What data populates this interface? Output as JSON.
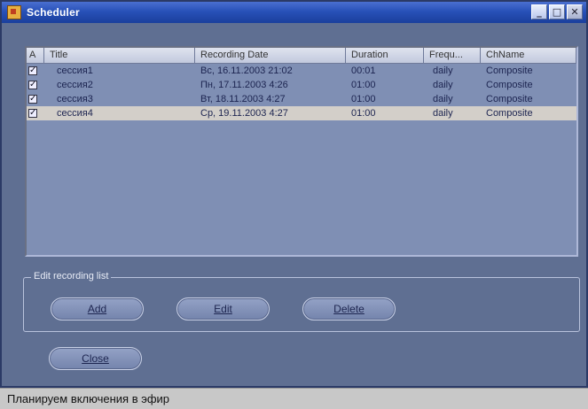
{
  "window": {
    "title": "Scheduler",
    "controls": [
      "minimize-icon",
      "maximize-icon",
      "close-icon"
    ]
  },
  "list": {
    "columns": [
      "A",
      "Title",
      "Recording Date",
      "Duration",
      "Frequ...",
      "ChName"
    ],
    "rows": [
      {
        "checked": true,
        "title": "сессия1",
        "date": "Вс, 16.11.2003 21:02",
        "duration": "00:01",
        "frequency": "daily",
        "channel": "Composite",
        "selected": false
      },
      {
        "checked": true,
        "title": "сессия2",
        "date": "Пн, 17.11.2003 4:26",
        "duration": "01:00",
        "frequency": "daily",
        "channel": "Composite",
        "selected": false
      },
      {
        "checked": true,
        "title": "сессия3",
        "date": "Вт, 18.11.2003 4:27",
        "duration": "01:00",
        "frequency": "daily",
        "channel": "Composite",
        "selected": false
      },
      {
        "checked": true,
        "title": "сессия4",
        "date": "Ср, 19.11.2003 4:27",
        "duration": "01:00",
        "frequency": "daily",
        "channel": "Composite",
        "selected": true
      }
    ]
  },
  "edit_group": {
    "label": "Edit recording list",
    "add_label": "Add",
    "edit_label": "Edit",
    "delete_label": "Delete"
  },
  "close_label": "Close",
  "caption": "Планируем включения в эфир",
  "colors": {
    "title_bar": "#2851b8",
    "window_bg": "#5f6f92",
    "list_bg": "#7f8fb4",
    "selected_row": "#d3cfc9"
  }
}
